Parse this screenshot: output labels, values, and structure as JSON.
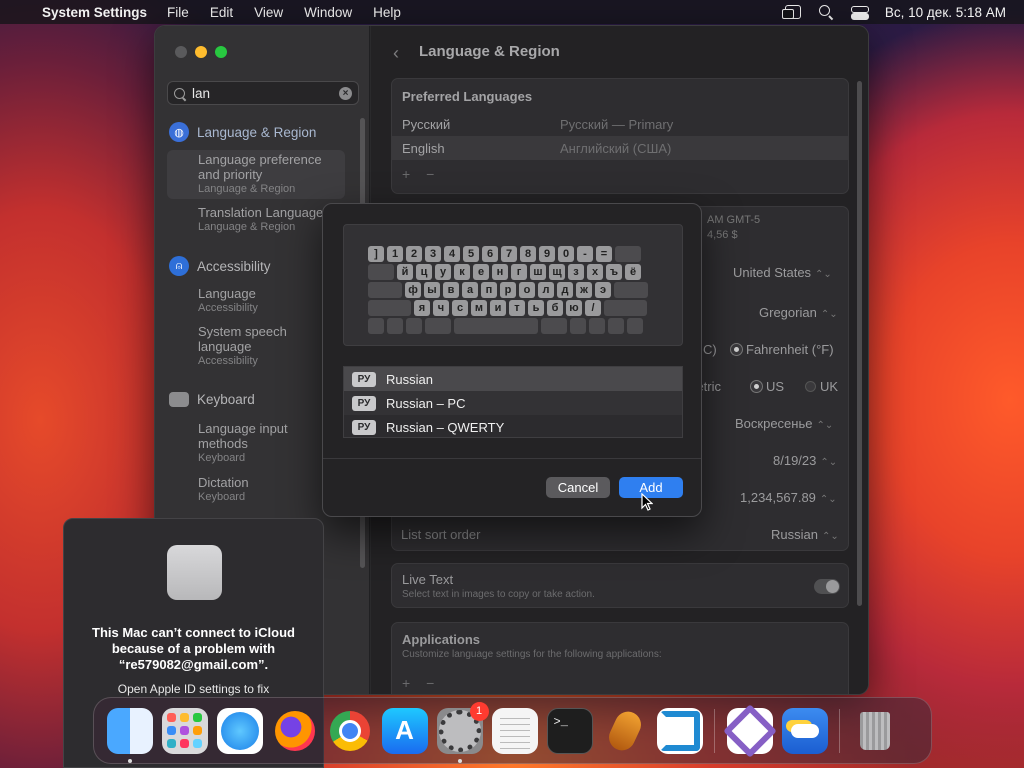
{
  "menubar": {
    "app_name": "System Settings",
    "menus": [
      "File",
      "Edit",
      "View",
      "Window",
      "Help"
    ],
    "clock": "Вс, 10 дек.  5:18 AM"
  },
  "sidebar": {
    "search_value": "lan",
    "sections": [
      {
        "label": "Language & Region",
        "items": [
          {
            "label": "Language preference and priority",
            "sub": "Language & Region"
          },
          {
            "label": "Translation Language",
            "sub": "Language & Region"
          }
        ]
      },
      {
        "label": "Accessibility",
        "items": [
          {
            "label": "Language",
            "sub": "Accessibility"
          },
          {
            "label": "System speech language",
            "sub": "Accessibility"
          }
        ]
      },
      {
        "label": "Keyboard",
        "items": [
          {
            "label": "Language input methods",
            "sub": "Keyboard"
          },
          {
            "label": "Dictation",
            "sub": "Keyboard"
          }
        ]
      }
    ]
  },
  "main": {
    "title": "Language & Region",
    "preferred": {
      "heading": "Preferred Languages",
      "rows": [
        {
          "name": "Русский",
          "detail": "Русский — Primary"
        },
        {
          "name": "English",
          "detail": "Английский (США)"
        }
      ],
      "controls": "+ −"
    },
    "time_fragment": "AM GMT-5",
    "time_fragment2": "4,56 $",
    "region_value": "United States",
    "calendar_value": "Gregorian",
    "temp_c": "C)",
    "temp_f": "Fahrenheit (°F)",
    "measure_metric": "Metric",
    "measure_us": "US",
    "measure_uk": "UK",
    "first_day": "Воскресенье",
    "date_format": "8/19/23",
    "number_format": "1,234,567.89",
    "list_sort_label": "List sort order",
    "list_sort_value": "Russian",
    "live_text": {
      "label": "Live Text",
      "desc": "Select text in images to copy or take action."
    },
    "applications": {
      "label": "Applications",
      "desc": "Customize language settings for the following applications:",
      "controls": "+ −"
    }
  },
  "dialog": {
    "keyboard_rows": [
      [
        "]",
        "1",
        "2",
        "3",
        "4",
        "5",
        "6",
        "7",
        "8",
        "9",
        "0",
        "-",
        "="
      ],
      [
        "й",
        "ц",
        "у",
        "к",
        "е",
        "н",
        "г",
        "ш",
        "щ",
        "з",
        "х",
        "ъ",
        "ё"
      ],
      [
        "ф",
        "ы",
        "в",
        "а",
        "п",
        "р",
        "о",
        "л",
        "д",
        "ж",
        "э"
      ],
      [
        "я",
        "ч",
        "с",
        "м",
        "и",
        "т",
        "ь",
        "б",
        "ю",
        "/"
      ]
    ],
    "layouts": [
      {
        "badge": "РУ",
        "name": "Russian"
      },
      {
        "badge": "РУ",
        "name": "Russian – PC"
      },
      {
        "badge": "РУ",
        "name": "Russian – QWERTY"
      }
    ],
    "cancel_label": "Cancel",
    "add_label": "Add"
  },
  "notice": {
    "title": "This Mac can’t connect to iCloud because of a problem with “re579082@gmail.com”.",
    "link": "Open Apple ID settings to fix"
  },
  "dock": {
    "apps": [
      "finder",
      "launchpad",
      "safari",
      "firefox",
      "chrome",
      "app-store",
      "system-settings",
      "textedit",
      "terminal",
      "garageband",
      "vscode",
      "visual-studio",
      "weather",
      "trash"
    ],
    "settings_badge": "1",
    "terminal_prompt": ">_"
  },
  "colors": {
    "accent": "#2f7ff0",
    "badge": "#ff3b30"
  }
}
